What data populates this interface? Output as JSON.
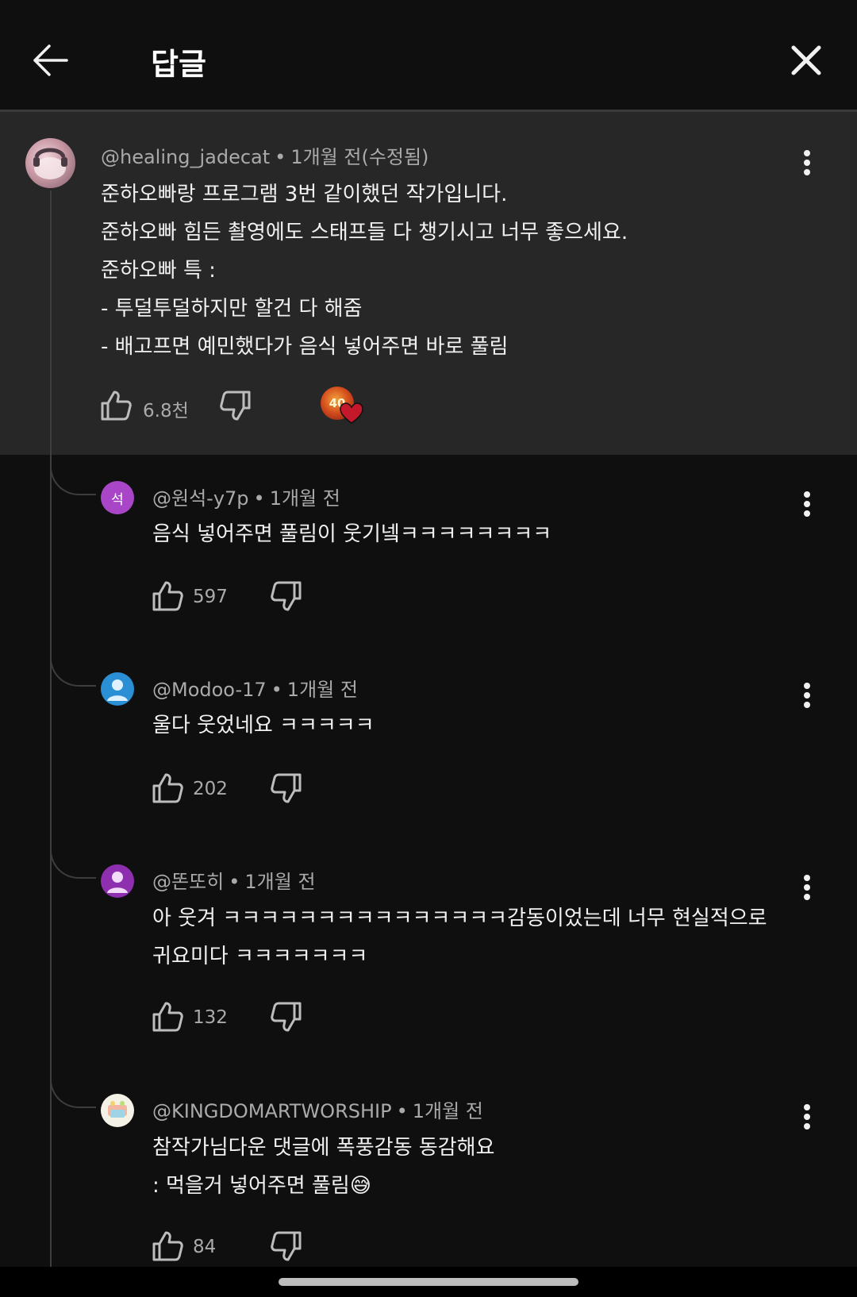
{
  "header": {
    "title": "답글"
  },
  "parent_comment": {
    "author": "@healing_jadecat",
    "separator": "•",
    "time": "1개월 전(수정됨)",
    "lines": [
      "준하오빠랑 프로그램 3번 같이했던 작가입니다.",
      "준하오빠 힘든 촬영에도 스태프들 다 챙기시고 너무 좋으세요.",
      "준하오빠 특 :",
      "- 투덜투덜하지만 할건 다 해줌",
      "- 배고프면 예민했다가 음식 넣어주면 바로 풀림"
    ],
    "likes": "6.8천",
    "creator_heart_badge_text": "40"
  },
  "replies": [
    {
      "author": "@원석-y7p",
      "separator": "•",
      "time": "1개월 전",
      "avatar_letter": "석",
      "avatar_color": "#a946c8",
      "lines": [
        "음식 넣어주면 풀림이 웃기넼ㅋㅋㅋㅋㅋㅋㅋㅋ"
      ],
      "likes": "597"
    },
    {
      "author": "@Modoo-17",
      "separator": "•",
      "time": "1개월 전",
      "avatar_color": "#2b8fd6",
      "lines": [
        "울다 웃었네요 ㅋㅋㅋㅋㅋ"
      ],
      "likes": "202"
    },
    {
      "author": "@똔또히",
      "separator": "•",
      "time": "1개월 전",
      "avatar_color": "#8e2fb0",
      "lines": [
        "아 웃겨 ㅋㅋㅋㅋㅋㅋㅋㅋㅋㅋㅋㅋㅋㅋㅋ감동이었는데 너무 현실적으로",
        "귀요미다 ㅋㅋㅋㅋㅋㅋㅋ"
      ],
      "likes": "132"
    },
    {
      "author": "@KINGDOMARTWORSHIP",
      "separator": "•",
      "time": "1개월 전",
      "avatar_color": "#f4f1e6",
      "lines": [
        "참작가님다운 댓글에 폭풍감동 동감해요",
        ": 먹을거 넣어주면 풀림😅"
      ],
      "likes": "84"
    }
  ],
  "colors": {
    "background": "#0f0f0f",
    "highlight_background": "#272727",
    "secondary_text": "#aaaaaa",
    "creator_heart": "#c4182b"
  },
  "icons": [
    "back-arrow-icon",
    "close-icon",
    "more-vert-icon",
    "thumb-up-icon",
    "thumb-down-icon",
    "creator-heart-icon"
  ]
}
